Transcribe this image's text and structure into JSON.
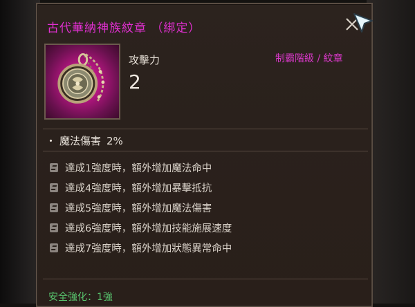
{
  "item": {
    "title": "古代華納神族紋章 （綁定）",
    "category": "制霸階級 / 紋章",
    "stat_label": "攻擊力",
    "stat_value": "2",
    "bonus": {
      "bullet": "・",
      "label": "魔法傷害",
      "value": "2%"
    },
    "set_effects": [
      "達成1強度時，額外增加魔法命中",
      "達成4強度時，額外增加暴擊抵抗",
      "達成5強度時，額外增加魔法傷害",
      "達成6強度時，額外增加技能施展速度",
      "達成7強度時，額外增加狀態異常命中"
    ],
    "safe_enhance": "安全強化：1強"
  },
  "colors": {
    "title": "#e02fd0",
    "category": "#d838c8",
    "safe_enhance": "#58c36d",
    "icon_background": "#c21a8f"
  },
  "icons": {
    "close": "close-x-icon",
    "cursor": "cursor-pointer-icon",
    "item": "emblem-medallion-icon",
    "set_effect": "set-effect-icon"
  }
}
